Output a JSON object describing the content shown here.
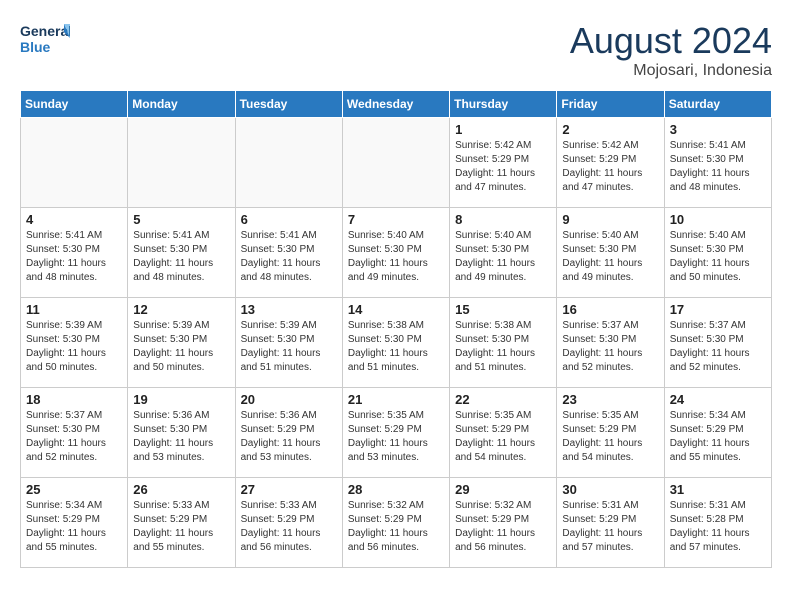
{
  "header": {
    "logo_line1": "General",
    "logo_line2": "Blue",
    "month": "August 2024",
    "location": "Mojosari, Indonesia"
  },
  "days_of_week": [
    "Sunday",
    "Monday",
    "Tuesday",
    "Wednesday",
    "Thursday",
    "Friday",
    "Saturday"
  ],
  "weeks": [
    [
      {
        "day": "",
        "info": ""
      },
      {
        "day": "",
        "info": ""
      },
      {
        "day": "",
        "info": ""
      },
      {
        "day": "",
        "info": ""
      },
      {
        "day": "1",
        "info": "Sunrise: 5:42 AM\nSunset: 5:29 PM\nDaylight: 11 hours\nand 47 minutes."
      },
      {
        "day": "2",
        "info": "Sunrise: 5:42 AM\nSunset: 5:29 PM\nDaylight: 11 hours\nand 47 minutes."
      },
      {
        "day": "3",
        "info": "Sunrise: 5:41 AM\nSunset: 5:30 PM\nDaylight: 11 hours\nand 48 minutes."
      }
    ],
    [
      {
        "day": "4",
        "info": "Sunrise: 5:41 AM\nSunset: 5:30 PM\nDaylight: 11 hours\nand 48 minutes."
      },
      {
        "day": "5",
        "info": "Sunrise: 5:41 AM\nSunset: 5:30 PM\nDaylight: 11 hours\nand 48 minutes."
      },
      {
        "day": "6",
        "info": "Sunrise: 5:41 AM\nSunset: 5:30 PM\nDaylight: 11 hours\nand 48 minutes."
      },
      {
        "day": "7",
        "info": "Sunrise: 5:40 AM\nSunset: 5:30 PM\nDaylight: 11 hours\nand 49 minutes."
      },
      {
        "day": "8",
        "info": "Sunrise: 5:40 AM\nSunset: 5:30 PM\nDaylight: 11 hours\nand 49 minutes."
      },
      {
        "day": "9",
        "info": "Sunrise: 5:40 AM\nSunset: 5:30 PM\nDaylight: 11 hours\nand 49 minutes."
      },
      {
        "day": "10",
        "info": "Sunrise: 5:40 AM\nSunset: 5:30 PM\nDaylight: 11 hours\nand 50 minutes."
      }
    ],
    [
      {
        "day": "11",
        "info": "Sunrise: 5:39 AM\nSunset: 5:30 PM\nDaylight: 11 hours\nand 50 minutes."
      },
      {
        "day": "12",
        "info": "Sunrise: 5:39 AM\nSunset: 5:30 PM\nDaylight: 11 hours\nand 50 minutes."
      },
      {
        "day": "13",
        "info": "Sunrise: 5:39 AM\nSunset: 5:30 PM\nDaylight: 11 hours\nand 51 minutes."
      },
      {
        "day": "14",
        "info": "Sunrise: 5:38 AM\nSunset: 5:30 PM\nDaylight: 11 hours\nand 51 minutes."
      },
      {
        "day": "15",
        "info": "Sunrise: 5:38 AM\nSunset: 5:30 PM\nDaylight: 11 hours\nand 51 minutes."
      },
      {
        "day": "16",
        "info": "Sunrise: 5:37 AM\nSunset: 5:30 PM\nDaylight: 11 hours\nand 52 minutes."
      },
      {
        "day": "17",
        "info": "Sunrise: 5:37 AM\nSunset: 5:30 PM\nDaylight: 11 hours\nand 52 minutes."
      }
    ],
    [
      {
        "day": "18",
        "info": "Sunrise: 5:37 AM\nSunset: 5:30 PM\nDaylight: 11 hours\nand 52 minutes."
      },
      {
        "day": "19",
        "info": "Sunrise: 5:36 AM\nSunset: 5:30 PM\nDaylight: 11 hours\nand 53 minutes."
      },
      {
        "day": "20",
        "info": "Sunrise: 5:36 AM\nSunset: 5:29 PM\nDaylight: 11 hours\nand 53 minutes."
      },
      {
        "day": "21",
        "info": "Sunrise: 5:35 AM\nSunset: 5:29 PM\nDaylight: 11 hours\nand 53 minutes."
      },
      {
        "day": "22",
        "info": "Sunrise: 5:35 AM\nSunset: 5:29 PM\nDaylight: 11 hours\nand 54 minutes."
      },
      {
        "day": "23",
        "info": "Sunrise: 5:35 AM\nSunset: 5:29 PM\nDaylight: 11 hours\nand 54 minutes."
      },
      {
        "day": "24",
        "info": "Sunrise: 5:34 AM\nSunset: 5:29 PM\nDaylight: 11 hours\nand 55 minutes."
      }
    ],
    [
      {
        "day": "25",
        "info": "Sunrise: 5:34 AM\nSunset: 5:29 PM\nDaylight: 11 hours\nand 55 minutes."
      },
      {
        "day": "26",
        "info": "Sunrise: 5:33 AM\nSunset: 5:29 PM\nDaylight: 11 hours\nand 55 minutes."
      },
      {
        "day": "27",
        "info": "Sunrise: 5:33 AM\nSunset: 5:29 PM\nDaylight: 11 hours\nand 56 minutes."
      },
      {
        "day": "28",
        "info": "Sunrise: 5:32 AM\nSunset: 5:29 PM\nDaylight: 11 hours\nand 56 minutes."
      },
      {
        "day": "29",
        "info": "Sunrise: 5:32 AM\nSunset: 5:29 PM\nDaylight: 11 hours\nand 56 minutes."
      },
      {
        "day": "30",
        "info": "Sunrise: 5:31 AM\nSunset: 5:29 PM\nDaylight: 11 hours\nand 57 minutes."
      },
      {
        "day": "31",
        "info": "Sunrise: 5:31 AM\nSunset: 5:28 PM\nDaylight: 11 hours\nand 57 minutes."
      }
    ]
  ]
}
